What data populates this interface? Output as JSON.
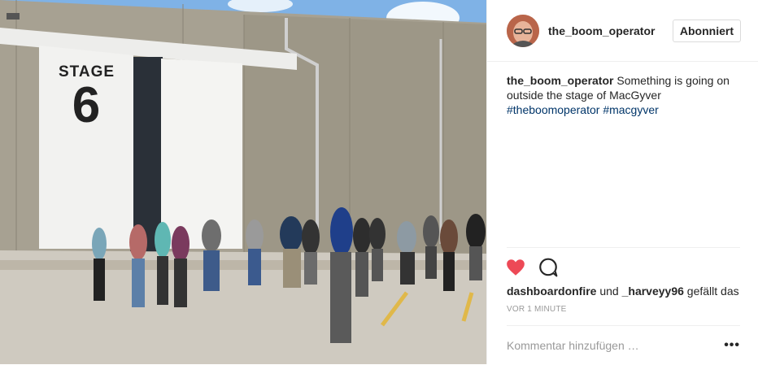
{
  "post": {
    "photo_sign": {
      "line1": "STAGE",
      "line2": "6"
    },
    "author": {
      "username": "the_boom_operator",
      "follow_label": "Abonniert"
    },
    "caption": {
      "username": "the_boom_operator",
      "text": "Something is going on outside the stage of MacGyver",
      "hashtags": [
        "#theboomoperator",
        "#macgyver"
      ]
    },
    "actions": {
      "like_icon": "heart-icon",
      "comment_icon": "comment-icon",
      "liked_color": "#ed4956"
    },
    "likes": {
      "user1": "dashboardonfire",
      "connector": "und",
      "user2": "_harveyy96",
      "suffix": "gefällt das"
    },
    "timestamp": "VOR 1 MINUTE",
    "comment": {
      "placeholder": "Kommentar hinzufügen …",
      "more_icon": "more-options-icon"
    }
  }
}
